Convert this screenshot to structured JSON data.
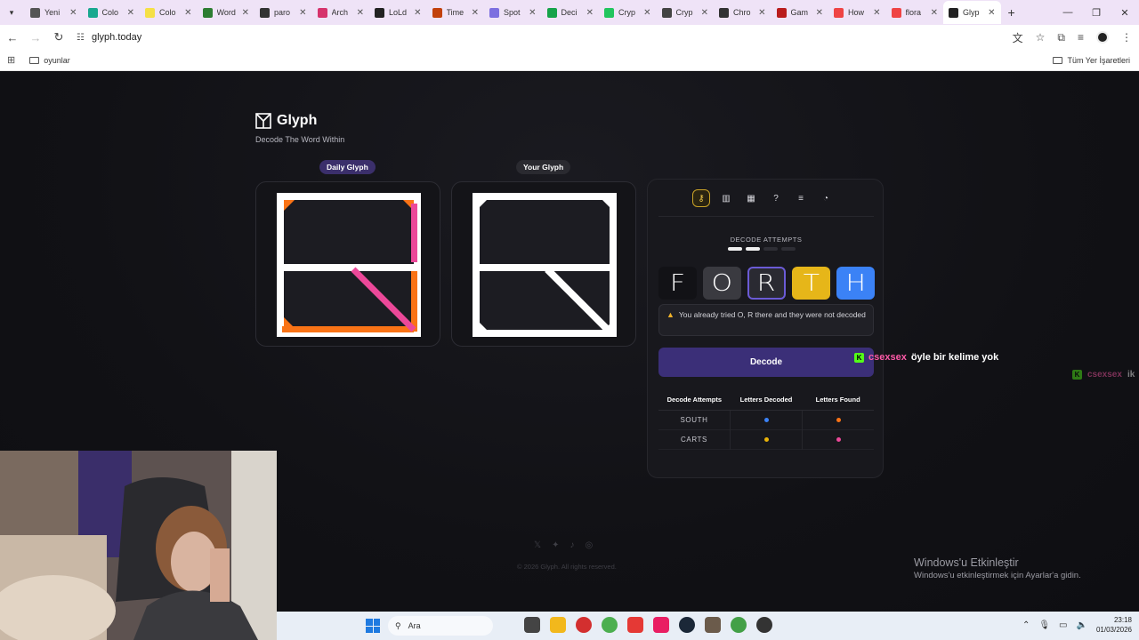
{
  "browser": {
    "tabs": [
      {
        "title": "Yeni",
        "color": "#555555"
      },
      {
        "title": "Colo",
        "color": "#19a88f"
      },
      {
        "title": "Colo",
        "color": "#f5e046"
      },
      {
        "title": "Word",
        "color": "#2d7d32"
      },
      {
        "title": "paro",
        "color": "#333333"
      },
      {
        "title": "Arch",
        "color": "#d6336c"
      },
      {
        "title": "LoLd",
        "color": "#222222"
      },
      {
        "title": "Time",
        "color": "#c2410c"
      },
      {
        "title": "Spot",
        "color": "#7c6fe0"
      },
      {
        "title": "Deci",
        "color": "#16a34a"
      },
      {
        "title": "Cryp",
        "color": "#22c55e"
      },
      {
        "title": "Cryp",
        "color": "#444444"
      },
      {
        "title": "Chro",
        "color": "#333333"
      },
      {
        "title": "Gam",
        "color": "#b91c1c"
      },
      {
        "title": "How",
        "color": "#ef4444"
      },
      {
        "title": "flora",
        "color": "#ef4444"
      },
      {
        "title": "Glyp",
        "color": "#222222",
        "active": true
      }
    ],
    "new_tab": "+",
    "url": "glyph.today",
    "bookmarks": {
      "folder": "oyunlar",
      "all_bookmarks": "Tüm Yer İşaretleri"
    }
  },
  "app": {
    "name": "Glyph",
    "tagline": "Decode The Word Within",
    "daily_label": "Daily Glyph",
    "yours_label": "Your Glyph"
  },
  "panel": {
    "attempts_label": "DECODE ATTEMPTS",
    "attempts_used": 2,
    "attempts_total": 4,
    "letters": [
      "F",
      "O",
      "R",
      "T",
      "H"
    ],
    "warning": "You already tried O, R there and they were not decoded",
    "decode_button": "Decode",
    "table": {
      "headers": [
        "Decode Attempts",
        "Letters Decoded",
        "Letters Found"
      ],
      "rows": [
        {
          "word": "SOUTH",
          "decoded_color": "#3b82f6",
          "found_color": "#f97316"
        },
        {
          "word": "CARTS",
          "decoded_color": "#eab308",
          "found_color": "#ec4899"
        }
      ]
    }
  },
  "footer": {
    "copyright": "© 2026 Glyph. All rights reserved."
  },
  "overlay": {
    "chat1_user": "csexsex",
    "chat1_msg": "öyle bir kelime yok",
    "chat2_user": "csexsex",
    "chat2_msg": "ik",
    "activation_title": "Windows'u Etkinleştir",
    "activation_sub": "Windows'u etkinleştirmek için Ayarlar'a gidin."
  },
  "taskbar": {
    "search_placeholder": "Ara",
    "time": "23:18",
    "date": "01/03/2026"
  },
  "colors": {
    "accent_purple": "#3b2f78",
    "glyph_orange": "#f97316",
    "glyph_pink": "#ec4899",
    "letter_yellow": "#e6b619",
    "letter_blue": "#3b82f6"
  }
}
